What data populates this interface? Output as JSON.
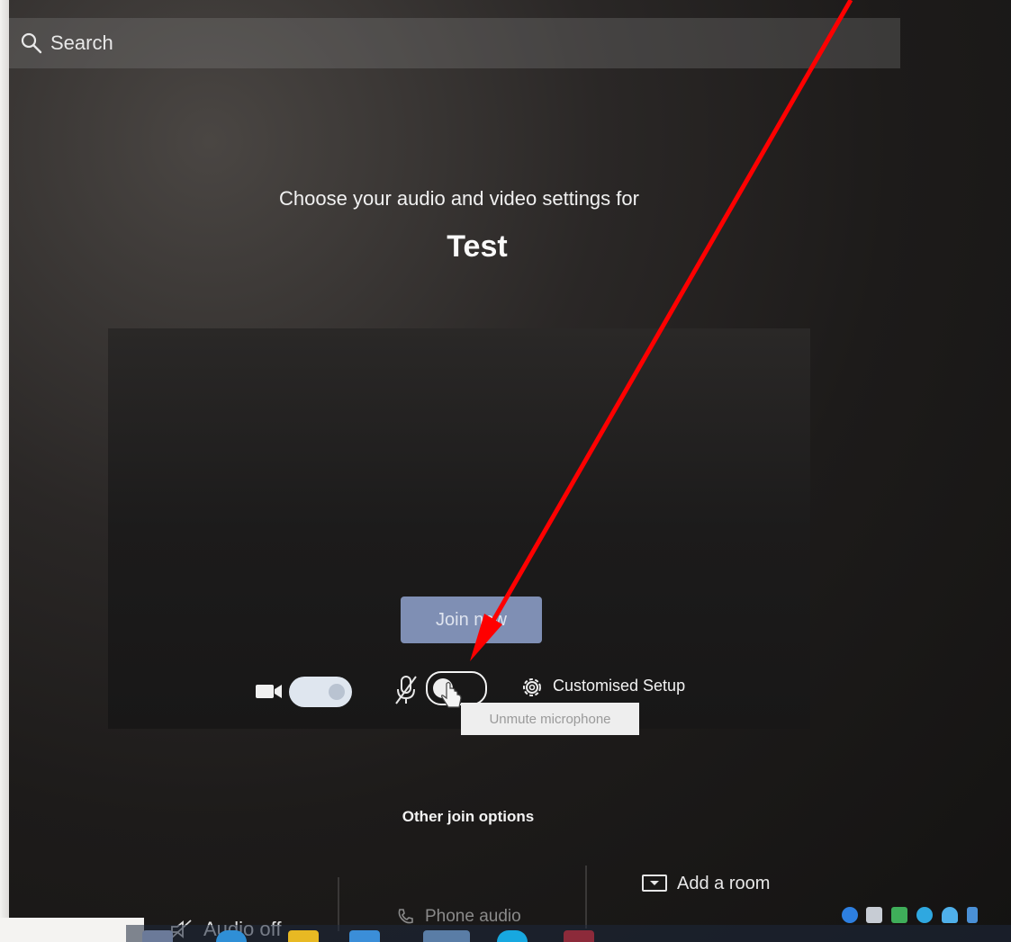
{
  "search": {
    "label": "Search"
  },
  "prejoin": {
    "heading": "Choose your audio and video settings for",
    "meeting_title": "Test",
    "join_button": "Join now",
    "camera_toggle_state": "on",
    "mic_toggle_state": "off",
    "custom_setup_label": "Customised Setup",
    "mic_tooltip": "Unmute microphone"
  },
  "join_options": {
    "title": "Other join options",
    "audio_off": "Audio off",
    "phone_audio": "Phone audio",
    "add_room": "Add a room"
  },
  "taskbar": {
    "icons": [
      "task-view-icon",
      "edge-icon",
      "file-explorer-icon",
      "internet-explorer-icon",
      "chrome-icon",
      "skype-icon",
      "calculator-app-icon"
    ],
    "tray": [
      "bluetooth-icon",
      "usb-icon",
      "tray-app-icon",
      "skype-tray-icon",
      "onedrive-icon",
      "people-icon"
    ]
  },
  "colors": {
    "annotation_arrow": "#ff0000",
    "join_button_bg": "#7f8fb4",
    "background": "#1d1b1a"
  }
}
